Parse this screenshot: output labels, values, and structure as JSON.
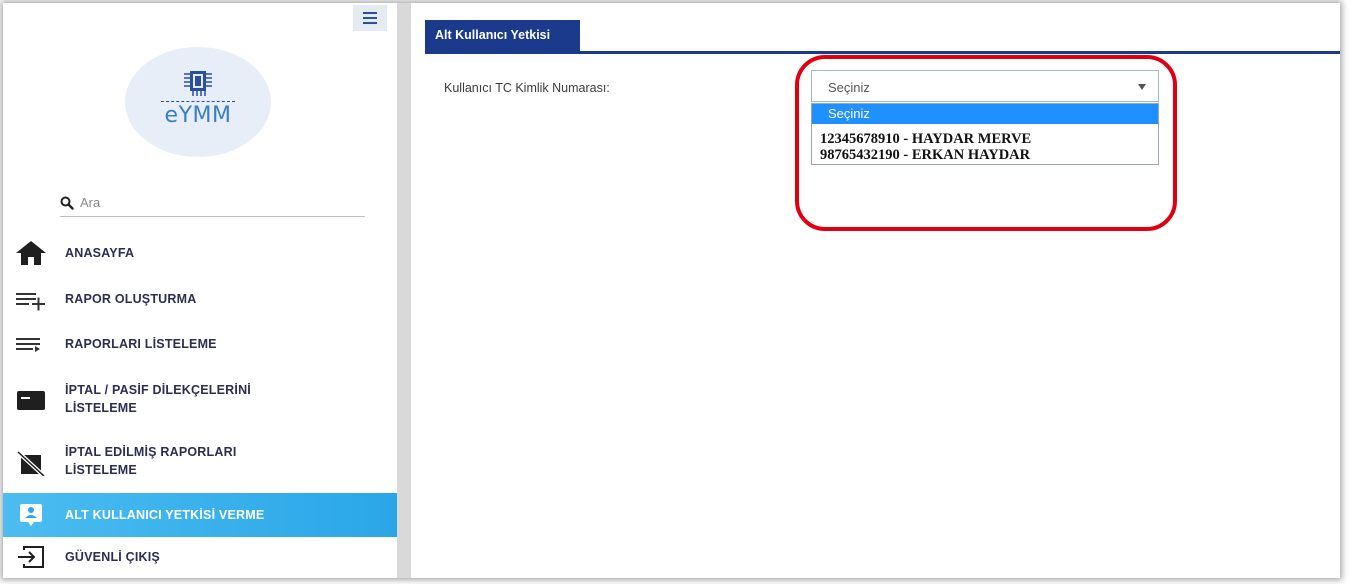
{
  "app": {
    "logo_text": "eYMM"
  },
  "search": {
    "placeholder": "Ara"
  },
  "nav": [
    {
      "label": "ANASAYFA",
      "icon": "home-icon"
    },
    {
      "label": "RAPOR OLUŞTURMA",
      "icon": "list-add-icon"
    },
    {
      "label": "RAPORLARI LİSTELEME",
      "icon": "list-play-icon"
    },
    {
      "label": "İPTAL / PASİF DİLEKÇELERİNİ",
      "label2": "LİSTELEME",
      "icon": "card-icon"
    },
    {
      "label": "İPTAL EDİLMİŞ RAPORLARI",
      "label2": "LİSTELEME",
      "icon": "cancelled-doc-icon"
    },
    {
      "label": "ALT KULLANICI YETKİSİ VERME",
      "icon": "user-badge-icon",
      "active": true
    },
    {
      "label": "GÜVENLİ ÇIKIŞ",
      "icon": "logout-icon"
    }
  ],
  "tab": {
    "label": "Alt Kullanıcı Yetkisi"
  },
  "form": {
    "label": "Kullanıcı TC Kimlik Numarası:",
    "select_value": "Seçiniz",
    "options": [
      "Seçiniz",
      "12345678910 - HAYDAR MERVE",
      "98765432190 - ERKAN HAYDAR"
    ]
  },
  "colors": {
    "accent": "#1b3a8c",
    "active_nav": "#2aa6e8",
    "highlight_ring": "#e1000f",
    "option_highlight": "#1e90ff"
  }
}
